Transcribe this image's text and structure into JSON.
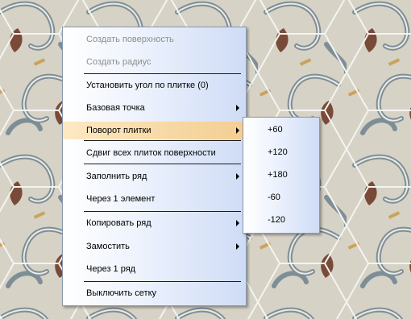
{
  "colors": {
    "menu_gradient_start": "#ffffff",
    "menu_gradient_end": "#cfdcf6",
    "active_item": "#f7d8a4",
    "disabled_text": "#8e8e8e",
    "tile_background": "#d6d2c6",
    "tile_hex_lines": "#f4f4f0",
    "tile_pattern_blue": "#7d8e97",
    "tile_pattern_brown": "#7a4a38",
    "tile_pattern_gold": "#caa35a"
  },
  "context_menu": {
    "items": [
      {
        "label": "Создать поверхность",
        "disabled": true
      },
      {
        "label": "Создать радиус",
        "disabled": true
      },
      {
        "label": "Установить угол по плитке (0)"
      },
      {
        "label": "Базовая точка",
        "has_submenu": true
      },
      {
        "label": "Поворот плитки",
        "has_submenu": true,
        "active": true
      },
      {
        "label": "Сдвиг всех плиток поверхности"
      },
      {
        "label": "Заполнить ряд",
        "has_submenu": true
      },
      {
        "label": "Через 1 элемент"
      },
      {
        "label": "Копировать ряд",
        "has_submenu": true
      },
      {
        "label": "Замостить",
        "has_submenu": true
      },
      {
        "label": "Через 1 ряд"
      },
      {
        "label": "Выключить сетку"
      }
    ]
  },
  "rotation_submenu": {
    "items": [
      {
        "label": "+60"
      },
      {
        "label": "+120"
      },
      {
        "label": "+180"
      },
      {
        "label": "-60"
      },
      {
        "label": "-120"
      }
    ]
  }
}
